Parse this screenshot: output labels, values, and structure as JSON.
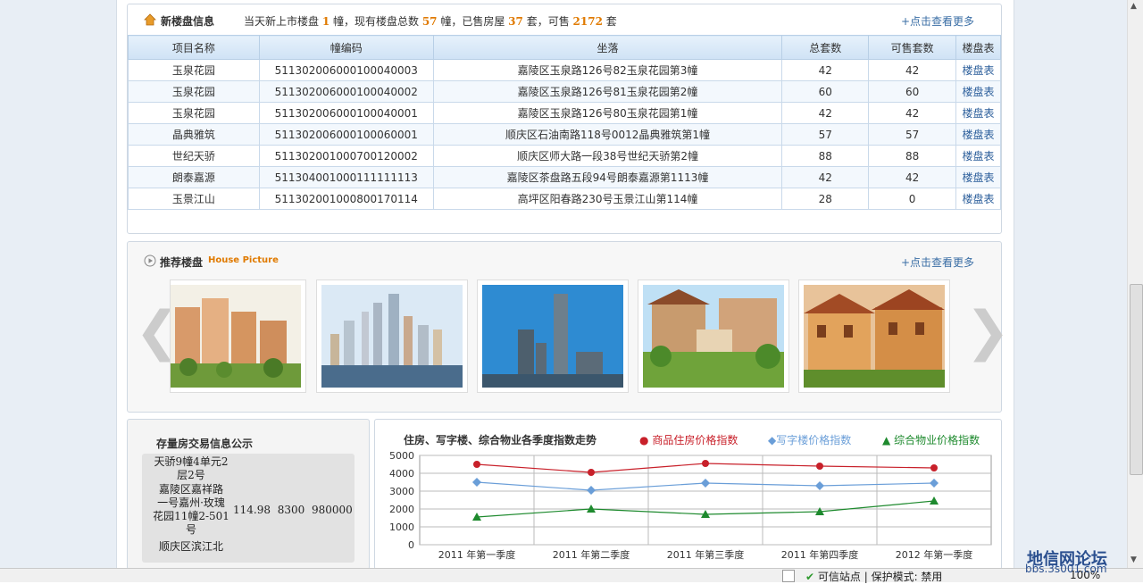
{
  "new_listings": {
    "title": "新楼盘信息",
    "summary": {
      "p1": "当天新上市楼盘 ",
      "today_count": "1",
      "p2": " 幢，现有楼盘总数 ",
      "total_buildings": "57",
      "p3": " 幢，已售房屋 ",
      "sold": "37",
      "p4": " 套，可售 ",
      "available": "2172",
      "p5": " 套"
    },
    "more_link": "+点击查看更多",
    "columns": [
      "项目名称",
      "幢编码",
      "坐落",
      "总套数",
      "可售套数",
      "楼盘表"
    ],
    "rows": [
      [
        "玉泉花园",
        "511302006000100040003",
        "嘉陵区玉泉路126号82玉泉花园第3幢",
        "42",
        "42",
        "楼盘表"
      ],
      [
        "玉泉花园",
        "511302006000100040002",
        "嘉陵区玉泉路126号81玉泉花园第2幢",
        "60",
        "60",
        "楼盘表"
      ],
      [
        "玉泉花园",
        "511302006000100040001",
        "嘉陵区玉泉路126号80玉泉花园第1幢",
        "42",
        "42",
        "楼盘表"
      ],
      [
        "晶典雅筑",
        "511302006000100060001",
        "顺庆区石油南路118号0012晶典雅筑第1幢",
        "57",
        "57",
        "楼盘表"
      ],
      [
        "世纪天骄",
        "511302001000700120002",
        "顺庆区师大路一段38号世纪天骄第2幢",
        "88",
        "88",
        "楼盘表"
      ],
      [
        "朗泰嘉源",
        "511304001000111111113",
        "嘉陵区茶盘路五段94号朗泰嘉源第1113幢",
        "42",
        "42",
        "楼盘表"
      ],
      [
        "玉景江山",
        "511302001000800170114",
        "高坪区阳春路230号玉景江山第114幢",
        "28",
        "0",
        "楼盘表"
      ]
    ]
  },
  "recommended": {
    "title": "推荐楼盘",
    "subtitle": "House Picture",
    "more_link": "+点击查看更多",
    "prev_arrow": "❮",
    "next_arrow": "❯",
    "images": [
      "apartment-towers-image",
      "city-skyline-image",
      "twin-towers-image",
      "villa-garden-image",
      "villa-houses-image"
    ]
  },
  "transactions": {
    "title": "存量房交易信息公示",
    "row_top": "天骄9幢4单元2\n层2号",
    "row_main": {
      "address": "嘉陵区嘉祥路\n一号嘉州·玫瑰\n花园11幢2-501\n号",
      "area": "114.98",
      "unit_price": "8300",
      "total": "980000"
    },
    "row_bottom": "顺庆区滨江北"
  },
  "index_chart": {
    "title": "住房、写字楼、综合物业各季度指数走势",
    "legend": [
      "商品住房价格指数",
      "写字楼价格指数",
      "综合物业价格指数"
    ],
    "legend_markers": [
      "●",
      "◆",
      "▲"
    ],
    "colors": [
      "#c8202a",
      "#6a9ed8",
      "#1e8a2e"
    ]
  },
  "chart_data": {
    "type": "line",
    "title": "住房、写字楼、综合物业各季度指数走势",
    "categories": [
      "2011 年第一季度",
      "2011 年第二季度",
      "2011 年第三季度",
      "2011 年第四季度",
      "2012 年第一季度"
    ],
    "series": [
      {
        "name": "商品住房价格指数",
        "values": [
          4500,
          4050,
          4550,
          4400,
          4300
        ],
        "color": "#c8202a",
        "marker": "circle"
      },
      {
        "name": "写字楼价格指数",
        "values": [
          3500,
          3050,
          3450,
          3300,
          3450
        ],
        "color": "#6a9ed8",
        "marker": "diamond"
      },
      {
        "name": "综合物业价格指数",
        "values": [
          1550,
          2000,
          1700,
          1850,
          2450
        ],
        "color": "#1e8a2e",
        "marker": "triangle"
      }
    ],
    "yticks": [
      0,
      1000,
      2000,
      3000,
      4000,
      5000
    ],
    "ylim": [
      0,
      5000
    ],
    "grid": true,
    "legend_position": "top-right"
  },
  "status_bar": {
    "trust": "可信站点 | 保护模式: 禁用",
    "zoom": "100%"
  },
  "watermark": {
    "text": "地信网论坛",
    "url": "bbs.3s001.com"
  }
}
